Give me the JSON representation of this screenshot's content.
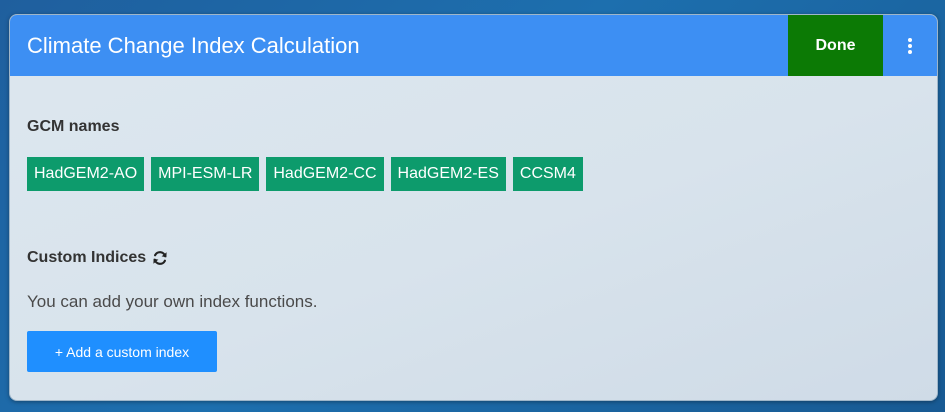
{
  "header": {
    "title": "Climate Change Index Calculation",
    "done_label": "Done",
    "menu_icon": "vertical-ellipsis-icon"
  },
  "gcm": {
    "label": "GCM names",
    "tags": [
      "HadGEM2-AO",
      "MPI-ESM-LR",
      "HadGEM2-CC",
      "HadGEM2-ES",
      "CCSM4"
    ]
  },
  "custom": {
    "label": "Custom Indices",
    "refresh_icon": "refresh-icon",
    "description": "You can add your own index functions.",
    "add_button_label": "+ Add a custom index"
  },
  "colors": {
    "header": "#3d8ff3",
    "done": "#0c7a05",
    "tag": "#0d9b6c",
    "add_button": "#1f8fff"
  }
}
